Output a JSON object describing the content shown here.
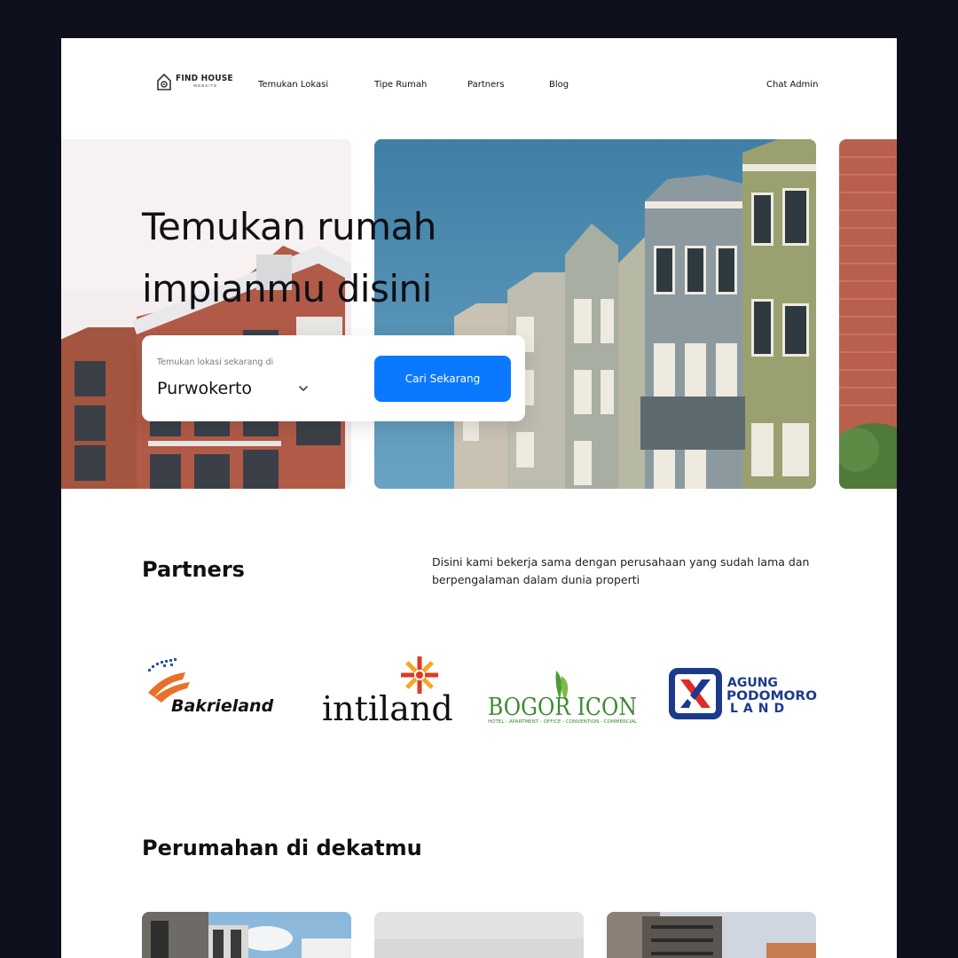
{
  "nav": {
    "logo_title": "FIND HOUSE",
    "logo_sub": "WEBSITE",
    "links": [
      "Temukan Lokasi",
      "Tipe Rumah",
      "Partners",
      "Blog"
    ],
    "chat": "Chat Admin"
  },
  "hero": {
    "title_line1": "Temukan rumah",
    "title_line2": "impianmu disini",
    "search_label": "Temukan lokasi sekarang di",
    "search_value": "Purwokerto",
    "search_button": "Cari Sekarang"
  },
  "partners": {
    "title": "Partners",
    "description": "Disini kami bekerja sama dengan perusahaan yang sudah lama dan berpengalaman dalam dunia properti",
    "logos": {
      "bakrieland": "Bakrieland",
      "intiland": "intiland",
      "bogoricon": "BOGOR ICON",
      "bogoricon_sub": "HOTEL - APARTMENT - OFFICE - CONVENTION - COMMERCIAL",
      "agung_1": "AGUNG",
      "agung_2": "PODOMORO",
      "agung_3": "LAND"
    }
  },
  "nearby": {
    "title": "Perumahan di dekatmu"
  },
  "colors": {
    "primary": "#0a78ff",
    "background_outer": "#0d0f1c",
    "text": "#0f0f14"
  }
}
